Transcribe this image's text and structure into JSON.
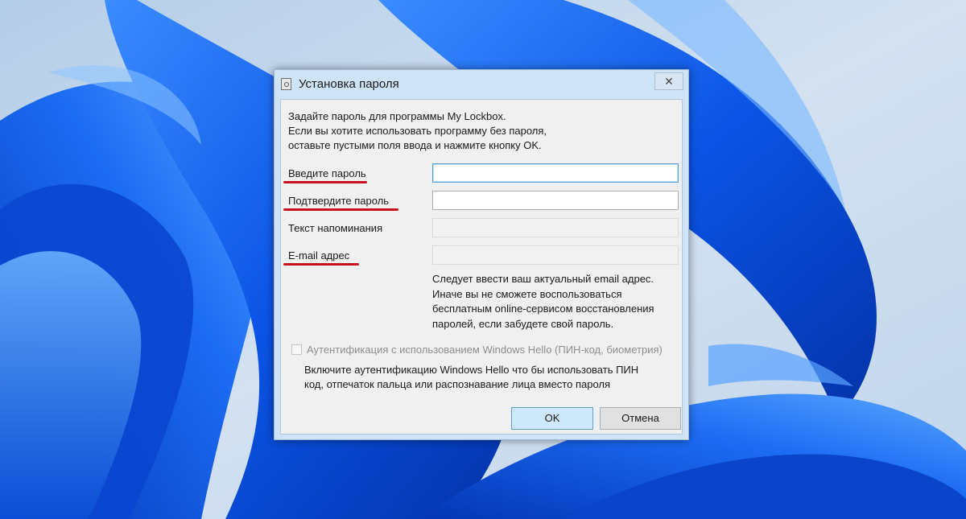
{
  "dialog": {
    "title": "Установка пароля",
    "close_glyph": "✕",
    "intro": [
      "Задайте пароль для программы My Lockbox.",
      "Если вы хотите использовать программу без пароля,",
      "оставьте пустыми поля ввода и нажмите кнопку OK."
    ],
    "fields": {
      "password": {
        "label": "Введите пароль",
        "value": ""
      },
      "confirm": {
        "label": "Подтвердите пароль",
        "value": ""
      },
      "hint": {
        "label": "Текст напоминания",
        "value": ""
      },
      "email": {
        "label": "E-mail адрес",
        "value": ""
      }
    },
    "email_hint": [
      "Следует ввести ваш актуальный email адрес.",
      "Иначе вы не сможете воспользоваться",
      "бесплатным online-сервисом восстановления",
      "паролей, если забудете свой пароль."
    ],
    "windows_hello": {
      "checkbox_label": "Аутентификация с использованием Windows Hello  (ПИН-код, биометрия)",
      "checked": false,
      "description": [
        "Включите аутентификацию Windows Hello что бы использовать ПИН",
        "код, отпечаток пальца или распознавание лица вместо пароля"
      ]
    },
    "buttons": {
      "ok": "OK",
      "cancel": "Отмена"
    }
  },
  "colors": {
    "annotation_underline": "#c8101e",
    "wallpaper_blue": "#0a55e0",
    "wallpaper_background": "#c9d9ee",
    "dialog_frame": "#cfe3f7",
    "ok_button": "#cde8fb"
  }
}
